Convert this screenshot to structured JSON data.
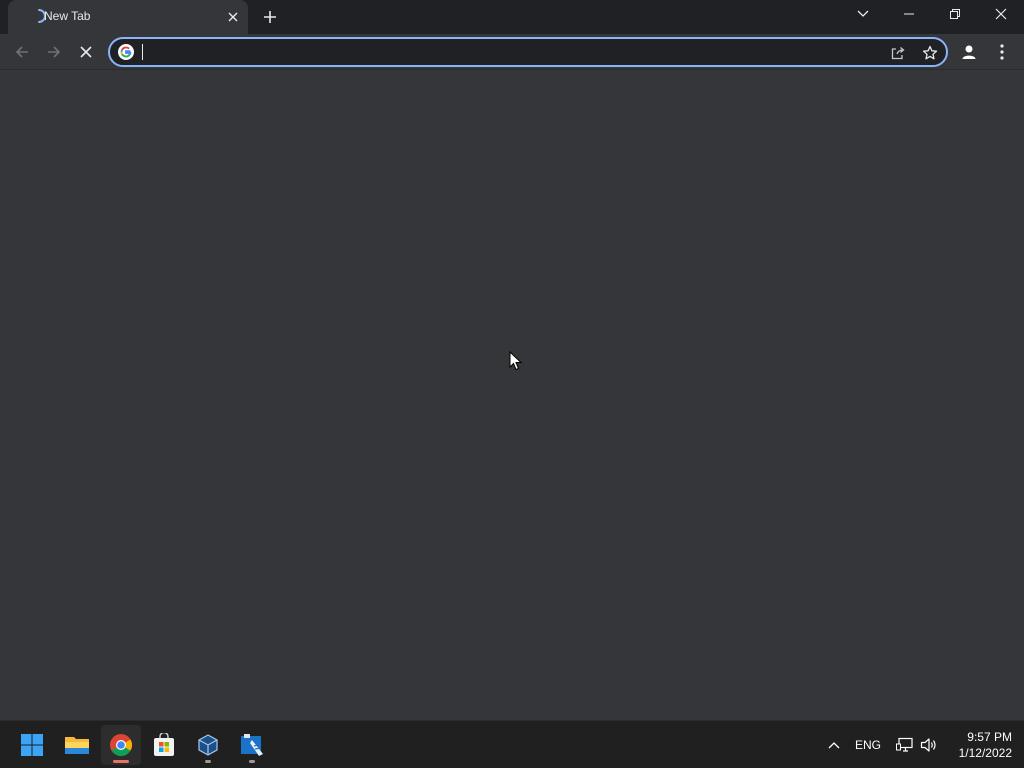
{
  "browser": {
    "tab": {
      "title": "New Tab"
    },
    "omnibox": {
      "value": "",
      "placeholder": ""
    }
  },
  "taskbar": {
    "apps": [
      {
        "name": "Start",
        "icon": "windows-start-icon"
      },
      {
        "name": "File Explorer",
        "icon": "folder-icon"
      },
      {
        "name": "Google Chrome",
        "icon": "chrome-icon",
        "active": true
      },
      {
        "name": "Microsoft Store",
        "icon": "store-icon"
      },
      {
        "name": "VirtualBox",
        "icon": "virtualbox-icon"
      },
      {
        "name": "App",
        "icon": "tool-icon"
      }
    ],
    "tray": {
      "language": "ENG",
      "time": "9:57 PM",
      "date": "1/12/2022"
    }
  },
  "colors": {
    "chrome_dark": "#202124",
    "chrome_toolbar": "#35363a",
    "accent_blue": "#8ab4f8",
    "taskbar": "#202020",
    "chrome_indicator": "#e8726a"
  }
}
